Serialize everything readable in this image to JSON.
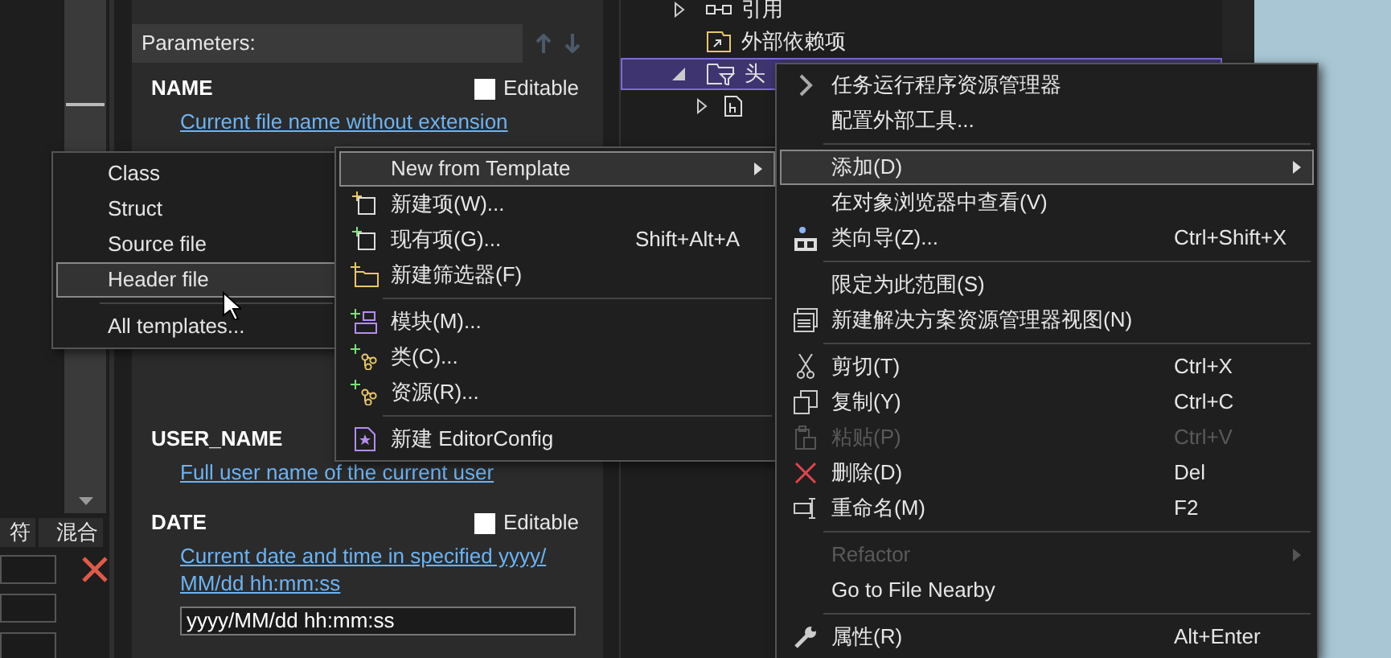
{
  "left_panel": {
    "columns": [
      "符",
      "混合"
    ],
    "fields": [
      {
        "has_error": true
      },
      {
        "has_error": false
      },
      {
        "has_error": false
      }
    ]
  },
  "parameters": {
    "title": "Parameters:",
    "items": [
      {
        "name": "NAME",
        "editable_label": "Editable",
        "editable": false,
        "description": [
          "Current file name without extension"
        ]
      },
      {
        "name": "USER_NAME",
        "description": [
          "Full user name of the current user"
        ]
      },
      {
        "name": "DATE",
        "editable_label": "Editable",
        "editable": false,
        "description": [
          "Current date and time in specified yyyy/",
          "MM/dd hh:mm:ss"
        ],
        "value": "yyyy/MM/dd hh:mm:ss"
      }
    ]
  },
  "tree": [
    {
      "label": "引用",
      "kind": "references",
      "expanded": false,
      "selected": false
    },
    {
      "label": "外部依赖项",
      "kind": "dependencies",
      "selected": false
    },
    {
      "label": "头",
      "kind": "filter",
      "expanded": true,
      "selected": true
    }
  ],
  "template_menu": [
    {
      "label": "Class",
      "selected": false
    },
    {
      "label": "Struct",
      "selected": false
    },
    {
      "label": "Source file",
      "selected": false
    },
    {
      "label": "Header file",
      "selected": true
    },
    {
      "kind": "separator"
    },
    {
      "label": "All templates...",
      "selected": false
    }
  ],
  "add_menu": [
    {
      "label": "New from Template",
      "submenu": true,
      "selected": true
    },
    {
      "label": "新建项(W)..."
    },
    {
      "label": "现有项(G)...",
      "shortcut": "Shift+Alt+A"
    },
    {
      "label": "新建筛选器(F)"
    },
    {
      "kind": "separator"
    },
    {
      "label": "模块(M)..."
    },
    {
      "label": "类(C)..."
    },
    {
      "label": "资源(R)..."
    },
    {
      "kind": "separator"
    },
    {
      "label": "新建 EditorConfig"
    }
  ],
  "context_menu": [
    {
      "label": "任务运行程序资源管理器"
    },
    {
      "label": "配置外部工具..."
    },
    {
      "kind": "separator"
    },
    {
      "label": "添加(D)",
      "submenu": true,
      "selected": true
    },
    {
      "label": "在对象浏览器中查看(V)"
    },
    {
      "label": "类向导(Z)...",
      "shortcut": "Ctrl+Shift+X"
    },
    {
      "kind": "separator"
    },
    {
      "label": "限定为此范围(S)"
    },
    {
      "label": "新建解决方案资源管理器视图(N)"
    },
    {
      "kind": "separator"
    },
    {
      "label": "剪切(T)",
      "shortcut": "Ctrl+X"
    },
    {
      "label": "复制(Y)",
      "shortcut": "Ctrl+C"
    },
    {
      "label": "粘贴(P)",
      "shortcut": "Ctrl+V",
      "disabled": true
    },
    {
      "label": "删除(D)",
      "shortcut": "Del"
    },
    {
      "label": "重命名(M)",
      "shortcut": "F2"
    },
    {
      "kind": "separator"
    },
    {
      "label": "Refactor",
      "submenu": true,
      "disabled": true
    },
    {
      "label": "Go to File Nearby"
    },
    {
      "kind": "separator"
    },
    {
      "label": "属性(R)",
      "shortcut": "Alt+Enter"
    }
  ]
}
